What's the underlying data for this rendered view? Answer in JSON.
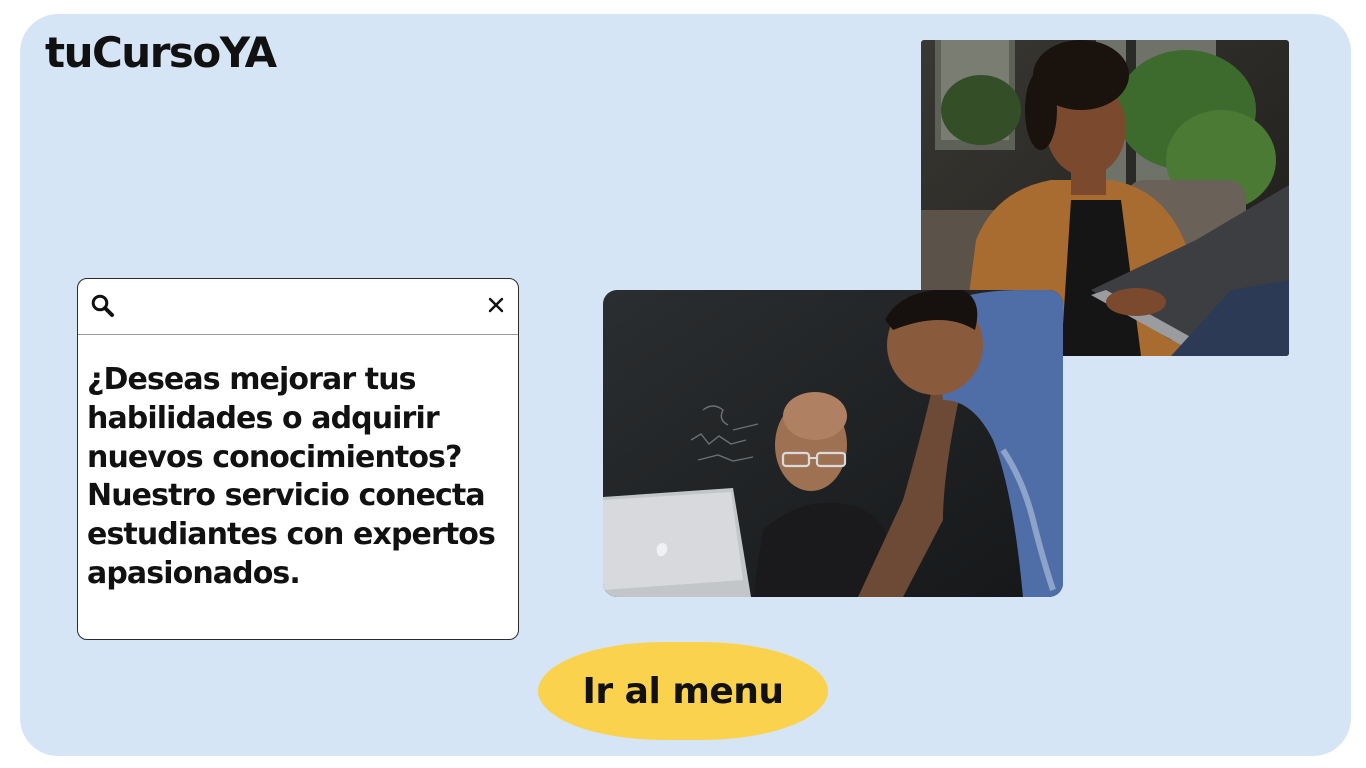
{
  "brand": {
    "logo_text": "tuCursoYA"
  },
  "search": {
    "value": "",
    "placeholder": "",
    "icon": "search-icon",
    "clear_icon": "close-icon"
  },
  "promo": {
    "text": "¿Deseas mejorar tus habilidades o adquirir nuevos conocimientos? Nuestro servicio conecta estudiantes con expertos apasionados."
  },
  "images": [
    {
      "name": "photo-student-laptop"
    },
    {
      "name": "photo-mentors-laptop"
    }
  ],
  "cta": {
    "label": "Ir al menu"
  },
  "colors": {
    "background": "#d6e5f6",
    "button": "#fbd24e",
    "text": "#111111"
  }
}
